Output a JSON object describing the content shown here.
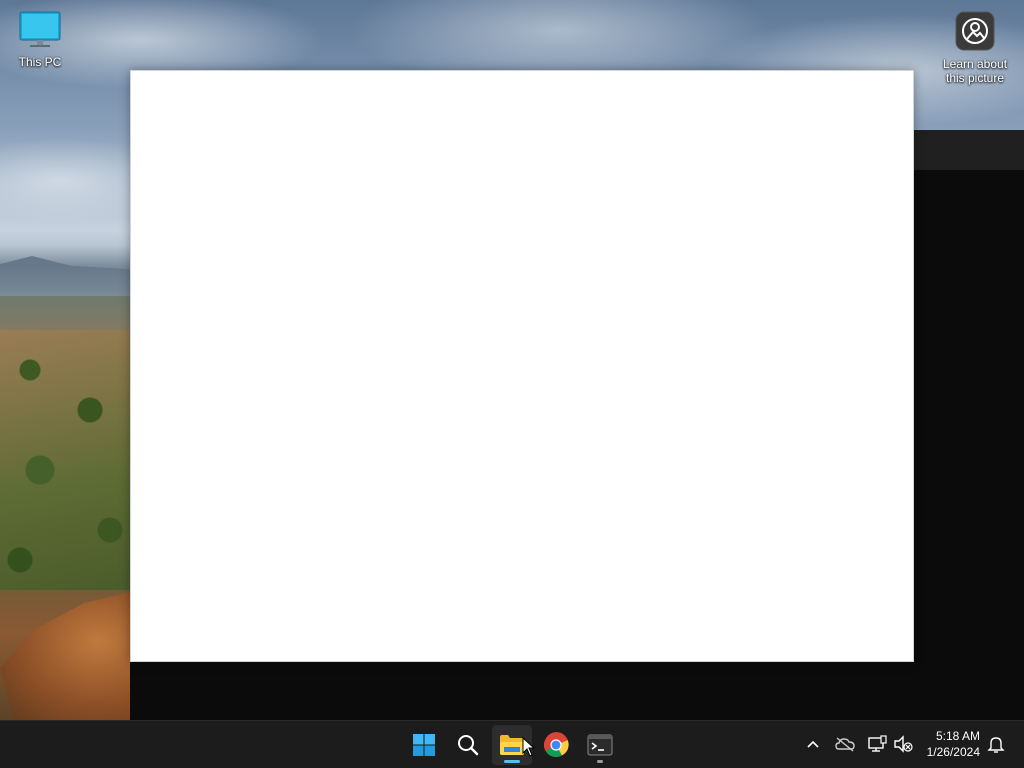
{
  "desktop": {
    "icons": [
      {
        "label": "This PC",
        "icon": "monitor-icon"
      },
      {
        "label": "Learn about\nthis picture",
        "line1": "Learn about",
        "line2": "this picture",
        "icon": "camera-info-icon"
      }
    ]
  },
  "taskbar": {
    "apps": [
      {
        "name": "Start",
        "icon": "windows-logo-icon"
      },
      {
        "name": "Search",
        "icon": "search-icon"
      },
      {
        "name": "File Explorer",
        "icon": "folder-icon",
        "active": true
      },
      {
        "name": "Google Chrome",
        "icon": "chrome-icon"
      },
      {
        "name": "Terminal",
        "icon": "terminal-icon",
        "running": true
      }
    ],
    "tray": {
      "icons": [
        "chevron-up-icon",
        "onedrive-offline-icon",
        "network-icon",
        "volume-muted-icon",
        "notification-bell-icon"
      ],
      "time": "5:18 AM",
      "date": "1/26/2024"
    }
  },
  "colors": {
    "accent": "#4cc2ff",
    "taskbar_bg": "#1c1c1c",
    "window_bg": "#ffffff",
    "dark_window_bg": "#0b0b0b"
  }
}
